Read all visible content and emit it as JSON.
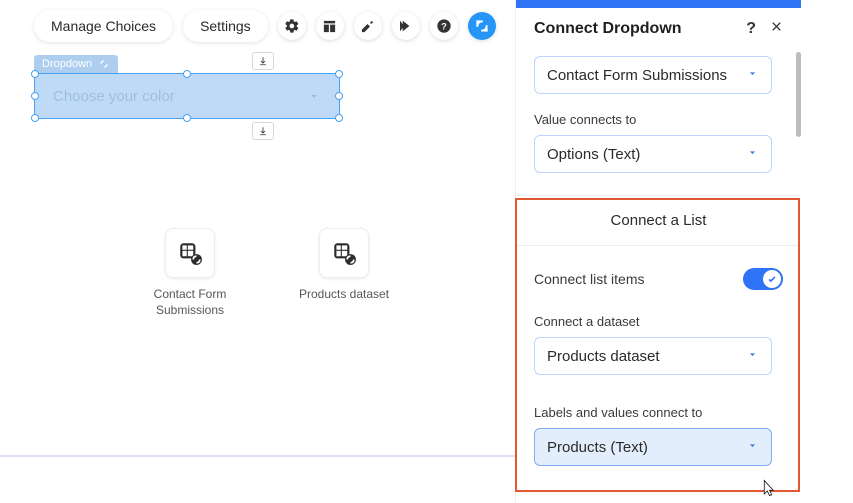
{
  "toolbar": {
    "manage_choices": "Manage Choices",
    "settings": "Settings"
  },
  "element": {
    "tag_label": "Dropdown",
    "placeholder": "Choose your color"
  },
  "canvas": {
    "datasets": [
      {
        "label": "Contact Form Submissions"
      },
      {
        "label": "Products dataset"
      }
    ]
  },
  "panel": {
    "title": "Connect Dropdown",
    "dataset_select": "Contact Form Submissions",
    "value_label": "Value connects to",
    "value_select": "Options (Text)",
    "list_group_title": "Connect a List",
    "list_toggle_label": "Connect list items",
    "list_toggle_on": true,
    "list_dataset_label": "Connect a dataset",
    "list_dataset_select": "Products dataset",
    "labels_connect_label": "Labels and values connect to",
    "labels_connect_select": "Products (Text)"
  }
}
